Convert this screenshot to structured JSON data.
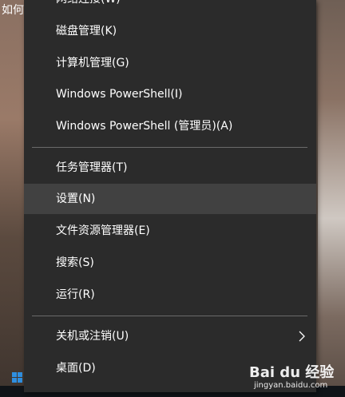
{
  "background": {
    "corner_text": "如何"
  },
  "menu": {
    "items": [
      {
        "label": "网络连接(W)"
      },
      {
        "label": "磁盘管理(K)"
      },
      {
        "label": "计算机管理(G)"
      },
      {
        "label": "Windows PowerShell(I)"
      },
      {
        "label": "Windows PowerShell (管理员)(A)"
      },
      {
        "label": "任务管理器(T)"
      },
      {
        "label": "设置(N)"
      },
      {
        "label": "文件资源管理器(E)"
      },
      {
        "label": "搜索(S)"
      },
      {
        "label": "运行(R)"
      },
      {
        "label": "关机或注销(U)"
      },
      {
        "label": "桌面(D)"
      }
    ],
    "highlighted": "设置(N)"
  },
  "watermark": {
    "brand": "Bai du 经验",
    "url": "jingyan.baidu.com"
  },
  "colors": {
    "menu_bg": "#2b2b2b",
    "hover_bg": "#414141",
    "separator": "#6a6a6a",
    "text": "#ffffff",
    "start_blue": "#2f8fe0"
  }
}
